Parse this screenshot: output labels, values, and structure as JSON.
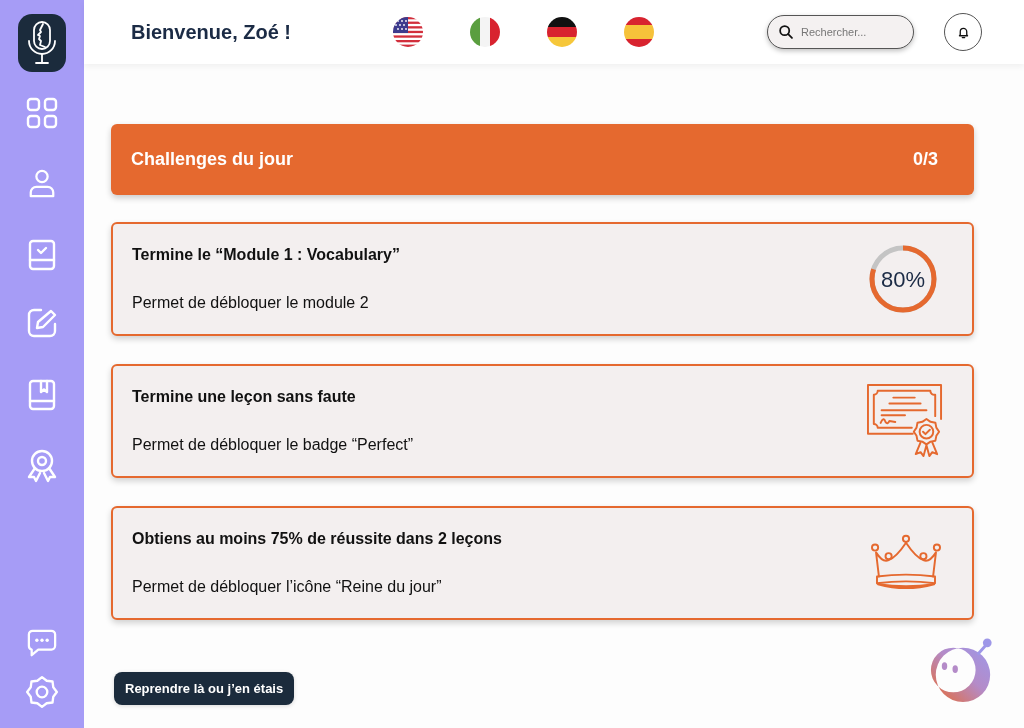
{
  "header": {
    "greeting": "Bienvenue, Zoé !",
    "search": {
      "placeholder": "Rechercher..."
    }
  },
  "challenges": {
    "title": "Challenges du jour",
    "count": "0/3",
    "items": [
      {
        "kind": "progress",
        "title": "Termine le “Module 1 : Vocabulary”",
        "subtitle": "Permet de débloquer le module 2",
        "level": 0.8,
        "reading": "80%"
      },
      {
        "kind": "certificate",
        "title": "Termine une leçon sans faute",
        "subtitle": "Permet de débloquer le badge “Perfect”"
      },
      {
        "kind": "crown",
        "title": "Obtiens au moins 75% de réussite dans 2 leçons",
        "subtitle": "Permet de débloquer l’icône “Reine du jour”"
      }
    ]
  },
  "resume_button": "Reprendre là ou j’en étais"
}
